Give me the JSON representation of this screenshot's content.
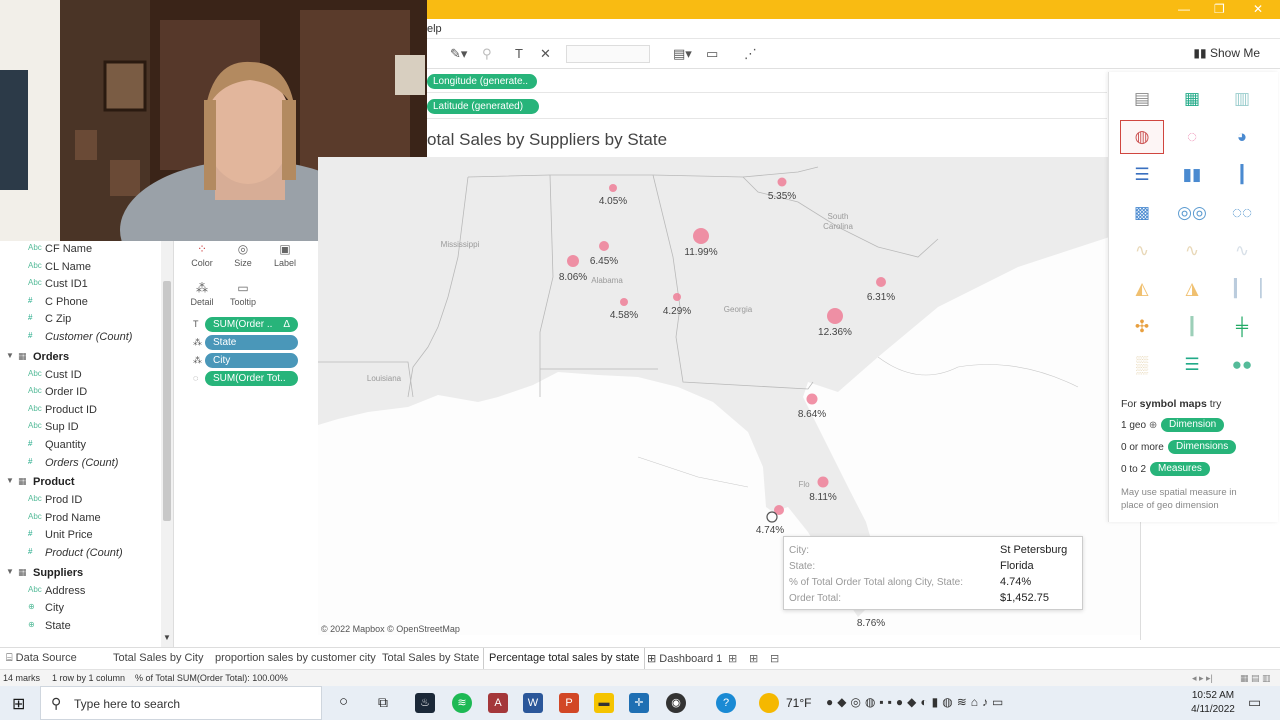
{
  "menu": {
    "help_fragment": "elp"
  },
  "toolbar": {
    "show_me_label": "Show Me"
  },
  "shelves": {
    "columns_pill": "Longitude (generate..",
    "rows_pill": "Latitude (generated)"
  },
  "view": {
    "title_fragment": "otal Sales by Suppliers by State"
  },
  "data_pane": {
    "items": [
      {
        "icon": "Abc",
        "label": "CF Name",
        "kind": "dim"
      },
      {
        "icon": "Abc",
        "label": "CL Name",
        "kind": "dim"
      },
      {
        "icon": "Abc",
        "label": "Cust ID1",
        "kind": "dim"
      },
      {
        "icon": "#",
        "label": "C Phone",
        "kind": "meas"
      },
      {
        "icon": "#",
        "label": "C Zip",
        "kind": "meas"
      },
      {
        "icon": "#",
        "label": "Customer (Count)",
        "kind": "meas",
        "italic": true
      },
      {
        "header": true,
        "label": "Orders"
      },
      {
        "icon": "Abc",
        "label": "Cust ID",
        "kind": "dim"
      },
      {
        "icon": "Abc",
        "label": "Order ID",
        "kind": "dim"
      },
      {
        "icon": "Abc",
        "label": "Product ID",
        "kind": "dim"
      },
      {
        "icon": "Abc",
        "label": "Sup ID",
        "kind": "dim"
      },
      {
        "icon": "#",
        "label": "Quantity",
        "kind": "meas"
      },
      {
        "icon": "#",
        "label": "Orders (Count)",
        "kind": "meas",
        "italic": true
      },
      {
        "header": true,
        "label": "Product"
      },
      {
        "icon": "Abc",
        "label": "Prod ID",
        "kind": "dim"
      },
      {
        "icon": "Abc",
        "label": "Prod Name",
        "kind": "dim"
      },
      {
        "icon": "#",
        "label": "Unit Price",
        "kind": "meas"
      },
      {
        "icon": "#",
        "label": "Product (Count)",
        "kind": "meas",
        "italic": true
      },
      {
        "header": true,
        "label": "Suppliers"
      },
      {
        "icon": "Abc",
        "label": "Address",
        "kind": "dim"
      },
      {
        "icon": "⊕",
        "label": "City",
        "kind": "dim"
      },
      {
        "icon": "⊕",
        "label": "State",
        "kind": "dim"
      }
    ]
  },
  "marks": {
    "color_label": "Color",
    "size_label": "Size",
    "label_label": "Label",
    "detail_label": "Detail",
    "tooltip_label": "Tooltip",
    "pills": [
      {
        "label": "SUM(Order ..",
        "color": "green",
        "icon": "T",
        "extra": "Δ"
      },
      {
        "label": "State",
        "color": "blue",
        "icon": "⁂",
        "extra": ""
      },
      {
        "label": "City",
        "color": "blue",
        "icon": "⁂",
        "extra": ""
      },
      {
        "label": "SUM(Order Tot..",
        "color": "green",
        "icon": "◌",
        "extra": ""
      }
    ]
  },
  "map": {
    "credit": "© 2022 Mapbox © OpenStreetMap",
    "state_labels": [
      {
        "text": "Mississippi"
      },
      {
        "text": "Alabama"
      },
      {
        "text": "Georgia"
      },
      {
        "text": "South\nCarolina"
      },
      {
        "text": "Louisiana"
      },
      {
        "text": "Flo"
      }
    ],
    "points": [
      {
        "label": "4.05%"
      },
      {
        "label": "5.35%"
      },
      {
        "label": "6.45%"
      },
      {
        "label": "11.99%"
      },
      {
        "label": "8.06%"
      },
      {
        "label": "4.58%"
      },
      {
        "label": "4.29%"
      },
      {
        "label": "6.31%"
      },
      {
        "label": "12.36%"
      },
      {
        "label": "8.64%"
      },
      {
        "label": "8.11%"
      },
      {
        "label": "4.74%"
      },
      {
        "label": "8.76%"
      }
    ]
  },
  "tooltip": {
    "rows": [
      {
        "key": "City:",
        "value": "St Petersburg"
      },
      {
        "key": "State:",
        "value": "Florida"
      },
      {
        "key": "% of Total Order Total along City, State:",
        "value": "4.74%"
      },
      {
        "key": "Order Total:",
        "value": "$1,452.75"
      }
    ]
  },
  "show_me": {
    "for_prefix": "For ",
    "for_bold": "symbol maps",
    "for_suffix": " try",
    "req1_prefix": "1 geo",
    "req1_pill": "Dimension",
    "req2_prefix": "0 or more",
    "req2_pill": "Dimensions",
    "req3_prefix": "0 to 2",
    "req3_pill": "Measures",
    "note_line1": "May use spatial measure in",
    "note_line2": "place of geo dimension"
  },
  "tabs": {
    "data_source": "Data Source",
    "sheets": [
      "Total Sales by City",
      "proportion sales by customer city",
      "Total Sales by State",
      "Percentage total sales by state",
      "Dashboard 1"
    ],
    "active_index": 3
  },
  "status": {
    "marks": "14 marks",
    "rows_cols": "1 row by 1 column",
    "sum": "% of Total SUM(Order Total): 100.00%"
  },
  "taskbar": {
    "search_placeholder": "Type here to search",
    "weather": "71°F",
    "time": "10:52 AM",
    "date": "4/11/2022"
  },
  "colors": {
    "accent_yellow": "#f9bb12",
    "pill_green": "#27b47a",
    "pill_blue": "#4a97b9",
    "mark_pink": "#ee7f98",
    "show_me_selected": "#d0463f"
  }
}
